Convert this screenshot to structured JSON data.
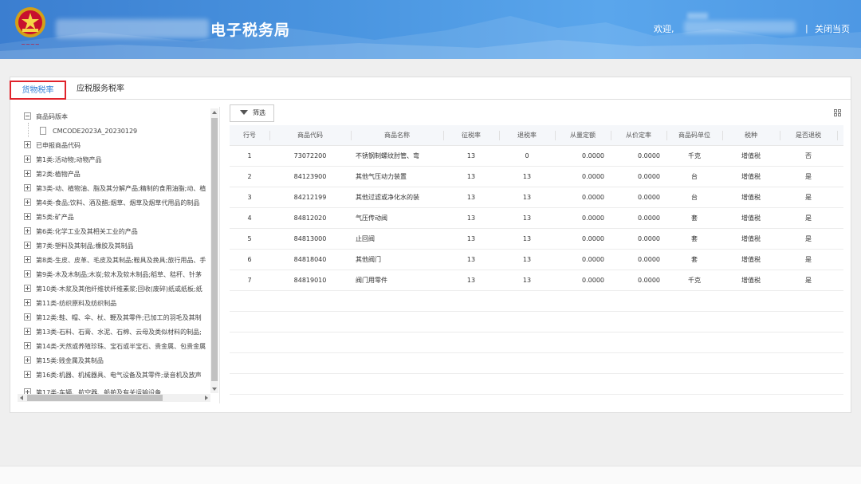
{
  "header": {
    "title": "电子税务局",
    "welcome": "欢迎,",
    "separator": "|",
    "close_link": "关闭当页"
  },
  "tabs": [
    {
      "label": "货物税率",
      "active": true
    },
    {
      "label": "应税服务税率",
      "active": false
    }
  ],
  "tree": {
    "root_label": "商品码版本",
    "version_label": "CMCODE2023A_20230129",
    "items": [
      "已申报商品代码",
      "第1类:活动物;动物产品",
      "第2类:植物产品",
      "第3类-动、植物油、脂及其分解产品;精制的食用油脂;动、植",
      "第4类-食品;饮料、酒及醋;烟草、烟草及烟草代用品的制品",
      "第5类:矿产品",
      "第6类:化学工业及其相关工业的产品",
      "第7类:塑料及其制品;橡胶及其制品",
      "第8类-生皮、皮革、毛皮及其制品;鞍具及挽具;旅行用品、手",
      "第9类-木及木制品;木炭;软木及软木制品;稻草、秸秆、针茅",
      "第10类-木浆及其他纤维状纤维素浆;回收(废碎)纸或纸板;纸",
      "第11类-纺织原料及纺织制品",
      "第12类:鞋、帽、伞、杖、鞭及其零件;已加工的羽毛及其制",
      "第13类-石料、石膏、水泥、石棉、云母及类似材料的制品;",
      "第14类-天然或养殖珍珠、宝石或半宝石、贵金属、包贵金属",
      "第15类:贱金属及其制品",
      "第16类:机器、机械器具、电气设备及其零件;录音机及放声",
      "第17类-车辆、航空器、船舶及有关运输设备"
    ]
  },
  "toolbar": {
    "filter_label": "筛选",
    "grid_icon": "grid-icon"
  },
  "table": {
    "columns": [
      "行号",
      "商品代码",
      "商品名称",
      "征税率",
      "退税率",
      "从量定额",
      "从价定率",
      "商品码单位",
      "税种",
      "是否退税"
    ],
    "rows": [
      [
        "1",
        "73072200",
        "不锈钢制螺纹肘管、弯",
        "13",
        "0",
        "0.0000",
        "0.0000",
        "千克",
        "增值税",
        "否"
      ],
      [
        "2",
        "84123900",
        "其他气压动力装置",
        "13",
        "13",
        "0.0000",
        "0.0000",
        "台",
        "增值税",
        "是"
      ],
      [
        "3",
        "84212199",
        "其他过滤或净化水的装",
        "13",
        "13",
        "0.0000",
        "0.0000",
        "台",
        "增值税",
        "是"
      ],
      [
        "4",
        "84812020",
        "气压传动阀",
        "13",
        "13",
        "0.0000",
        "0.0000",
        "套",
        "增值税",
        "是"
      ],
      [
        "5",
        "84813000",
        "止回阀",
        "13",
        "13",
        "0.0000",
        "0.0000",
        "套",
        "增值税",
        "是"
      ],
      [
        "6",
        "84818040",
        "其他阀门",
        "13",
        "13",
        "0.0000",
        "0.0000",
        "套",
        "增值税",
        "是"
      ],
      [
        "7",
        "84819010",
        "阀门用零件",
        "13",
        "13",
        "0.0000",
        "0.0000",
        "千克",
        "增值税",
        "是"
      ]
    ]
  },
  "colors": {
    "header_blue": "#4a95e0",
    "active_tab_text": "#2f7fd6",
    "highlight_border": "#e0232b"
  }
}
